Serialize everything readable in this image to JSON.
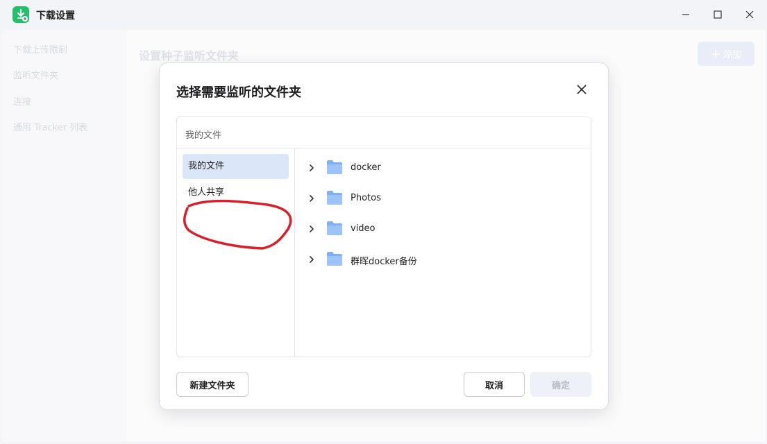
{
  "window": {
    "title": "下载设置",
    "controls": {
      "minimize": "minimize-icon",
      "maximize": "maximize-icon",
      "close": "close-icon"
    }
  },
  "sidebar": {
    "items": [
      {
        "label": "下载上传限制"
      },
      {
        "label": "监听文件夹"
      },
      {
        "label": "连接"
      },
      {
        "label": "通用 Tracker 列表"
      }
    ]
  },
  "main": {
    "title": "设置种子监听文件夹",
    "add_button": "添加"
  },
  "dialog": {
    "title": "选择需要监听的文件夹",
    "path": "我的文件",
    "locations": [
      {
        "label": "我的文件",
        "selected": true
      },
      {
        "label": "他人共享",
        "selected": false
      }
    ],
    "folders": [
      {
        "name": "docker"
      },
      {
        "name": "Photos"
      },
      {
        "name": "video"
      },
      {
        "name": "群晖docker备份"
      }
    ],
    "buttons": {
      "new_folder": "新建文件夹",
      "cancel": "取消",
      "confirm": "确定"
    }
  },
  "colors": {
    "accent_green": "#21c16b",
    "selection_blue": "#dbe6f8",
    "folder_blue": "#7fb0f5",
    "annotation_red": "#d6202c"
  }
}
